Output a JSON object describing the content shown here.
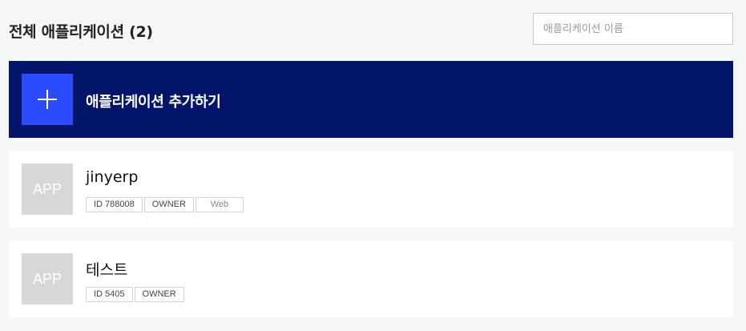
{
  "header": {
    "title": "전체 애플리케이션 (2)",
    "search_placeholder": "애플리케이션 이름"
  },
  "add_app": {
    "label": "애플리케이션 추가하기"
  },
  "apps": [
    {
      "thumb_text": "APP",
      "name": "jinyerp",
      "tags": [
        "ID 788008",
        "OWNER",
        "Web"
      ]
    },
    {
      "thumb_text": "APP",
      "name": "테스트",
      "tags": [
        "ID 5405",
        "OWNER"
      ]
    }
  ],
  "colors": {
    "background": "#f5f6f6",
    "add_banner": "#03146b",
    "plus_box": "#2c4bfd",
    "thumb": "#d7d7d7"
  }
}
